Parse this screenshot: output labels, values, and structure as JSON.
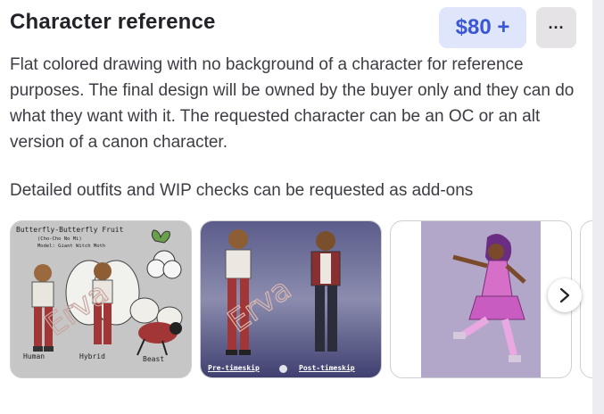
{
  "listing": {
    "title": "Character reference",
    "price": "$80 +",
    "more": "···",
    "description": "Flat colored drawing with no background of a character for reference purposes. The final design will be owned by the buyer only and they can do what they want with it. The requested character can be an OC or an alt version of a canon character.",
    "addons": "Detailed outfits and WIP checks can be requested as add-ons"
  },
  "gallery": {
    "image1": {
      "heading": "Butterfly-Butterfly Fruit",
      "sub1": "(Cho-Cho No Mi)",
      "sub2": "Model: Giant Witch Moth",
      "labels": [
        "Human",
        "Hybrid",
        "Beast"
      ]
    },
    "image2": {
      "labels": [
        "Pre-timeskip",
        "Post-timeskip"
      ]
    },
    "next_icon": "chevron-right-icon"
  }
}
